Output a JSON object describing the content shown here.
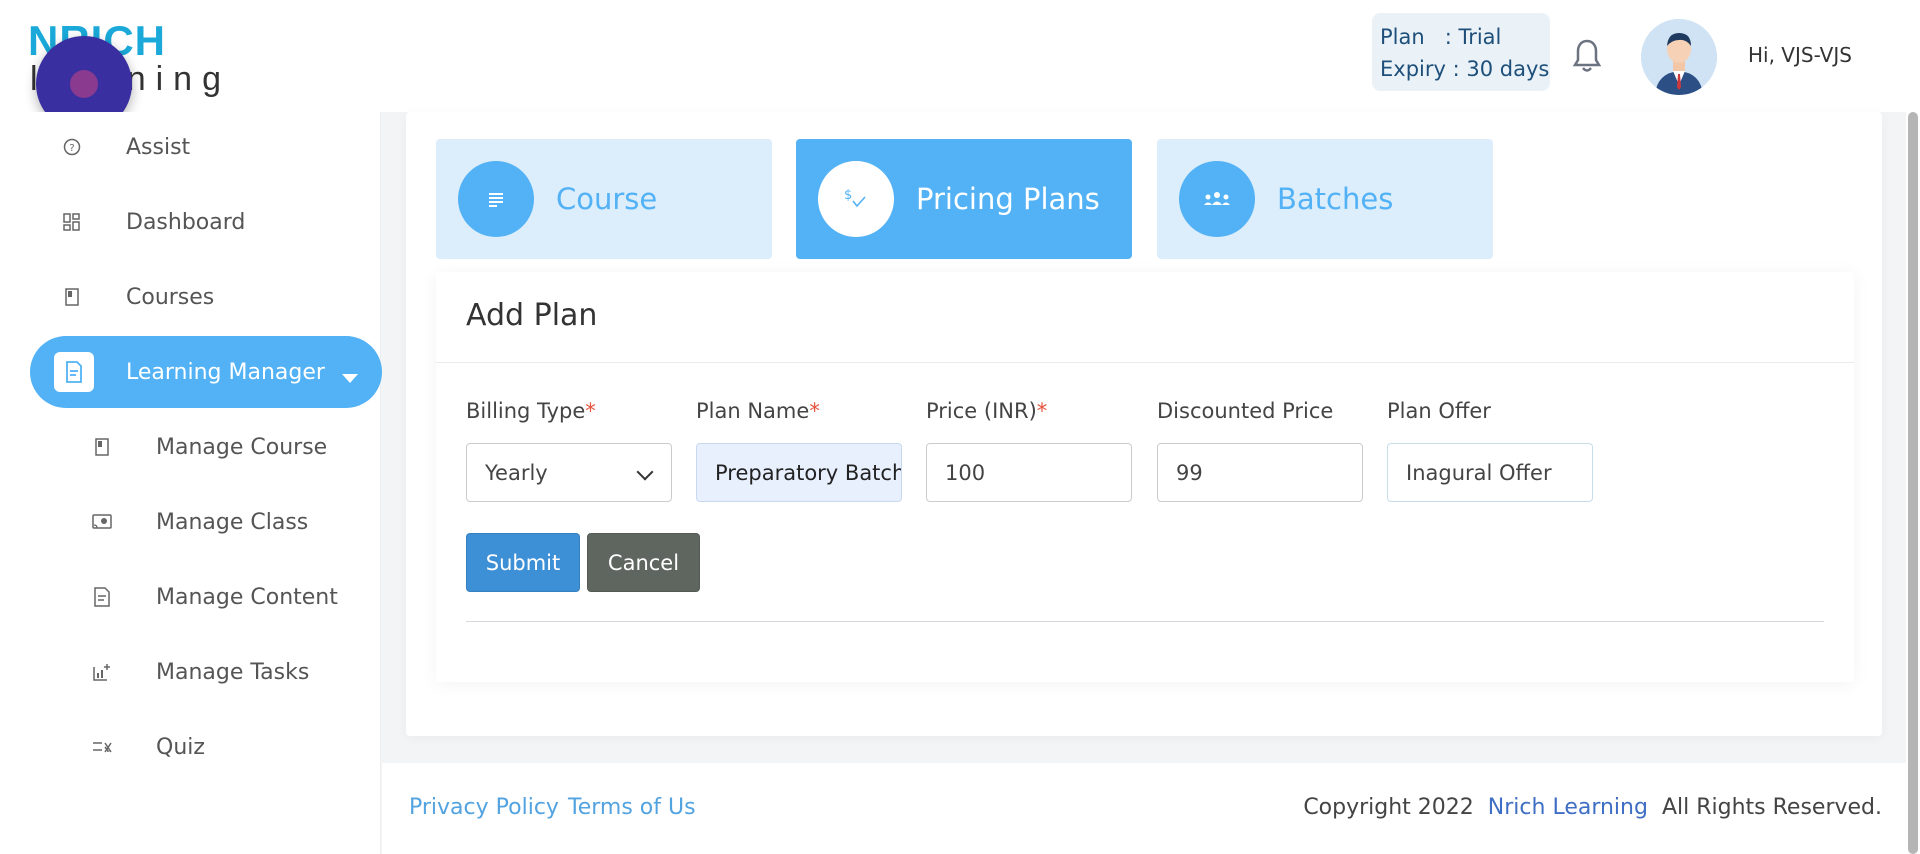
{
  "logo": {
    "top_text": "NRICH",
    "bottom_text": "learning"
  },
  "plan_info": {
    "plan_line": "Plan   : Trial",
    "expiry_line": "Expiry : 30 days"
  },
  "user": {
    "greeting": "Hi, VJS-VJS"
  },
  "sidebar": {
    "items": [
      {
        "label": "Assist",
        "icon": "help-circle-icon"
      },
      {
        "label": "Dashboard",
        "icon": "dashboard-grid-icon"
      },
      {
        "label": "Courses",
        "icon": "book-icon"
      },
      {
        "label": "Learning Manager",
        "icon": "document-icon",
        "active": true
      },
      {
        "label": "Manage Course",
        "icon": "book-icon"
      },
      {
        "label": "Manage Class",
        "icon": "cast-icon"
      },
      {
        "label": "Manage Content",
        "icon": "document-icon"
      },
      {
        "label": "Manage Tasks",
        "icon": "chart-plus-icon"
      },
      {
        "label": "Quiz",
        "icon": "checklist-icon"
      }
    ]
  },
  "steps": [
    {
      "label": "Course",
      "icon": "list-icon"
    },
    {
      "label": "Pricing Plans",
      "icon": "price-check-icon",
      "active": true
    },
    {
      "label": "Batches",
      "icon": "group-icon"
    }
  ],
  "form": {
    "title": "Add Plan",
    "billing_type": {
      "label": "Billing Type",
      "value": "Yearly"
    },
    "plan_name": {
      "label": "Plan Name",
      "value": "Preparatory Batch"
    },
    "price": {
      "label": "Price (INR)",
      "value": "100"
    },
    "discounted_price": {
      "label": "Discounted Price",
      "value": "99"
    },
    "plan_offer": {
      "label": "Plan Offer",
      "value": "Inagural Offer"
    },
    "required_mark": "*",
    "submit_label": "Submit",
    "cancel_label": "Cancel"
  },
  "footer": {
    "privacy": "Privacy Policy",
    "terms": "Terms of Us",
    "copyright_prefix": "Copyright 2022",
    "brand": "Nrich Learning",
    "copyright_suffix": "All Rights Reserved."
  },
  "colors": {
    "accent": "#52b2f5",
    "submit": "#3d8fd6",
    "cancel": "#5f655f",
    "required": "#e5533d"
  }
}
